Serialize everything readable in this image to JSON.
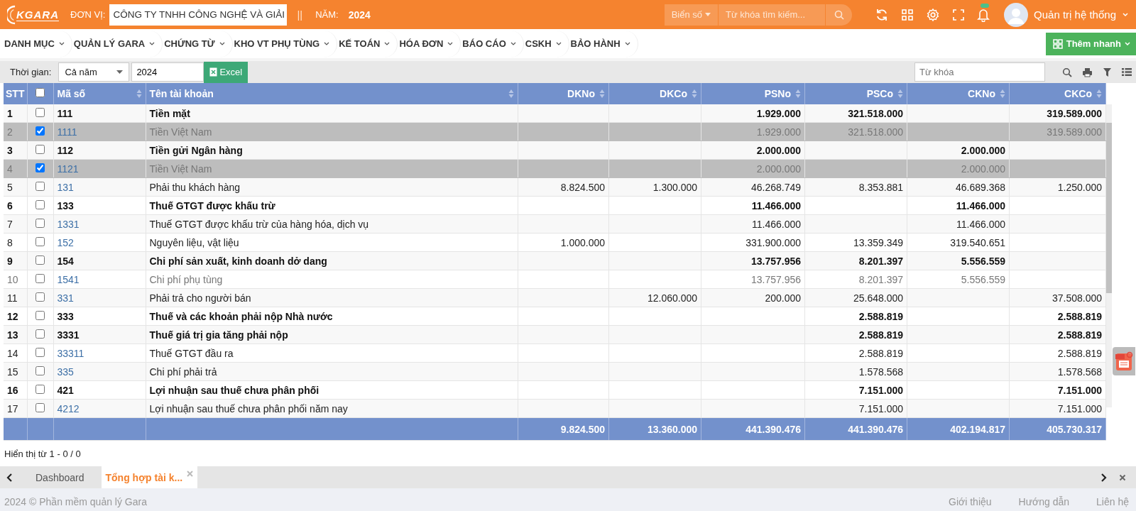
{
  "header": {
    "logo": "KGARA",
    "unit_label": "ĐƠN VỊ:",
    "unit_value": "CÔNG TY TNHH CÔNG NGHỆ VÀ GIẢI",
    "separator": "||",
    "year_label": "NĂM:",
    "year": "2024",
    "plate_filter": "Biển số",
    "search": {
      "placeholder": "Từ khóa tìm kiếm..."
    },
    "user": "Quản trị hệ thống"
  },
  "menu": [
    {
      "label": "DANH MỤC"
    },
    {
      "label": "QUẢN LÝ GARA"
    },
    {
      "label": "CHỨNG TỪ"
    },
    {
      "label": "KHO VT PHỤ TÙNG"
    },
    {
      "label": "KẾ TOÁN"
    },
    {
      "label": "HÓA ĐƠN"
    },
    {
      "label": "BÁO CÁO"
    },
    {
      "label": "CSKH"
    },
    {
      "label": "BẢO HÀNH"
    }
  ],
  "quick_add": "Thêm nhanh",
  "toolbar": {
    "time_label": "Thời gian:",
    "period": "Cả năm",
    "year": "2024",
    "excel": "Excel",
    "keyword": {
      "placeholder": "Từ khóa"
    }
  },
  "table": {
    "select_all_checked": false,
    "columns": [
      {
        "label": "STT"
      },
      {
        "label": "Mã số",
        "sortable": true
      },
      {
        "label": "Tên tài khoản",
        "sortable": true
      },
      {
        "label": "DKNo",
        "sortable": true
      },
      {
        "label": "DKCo",
        "sortable": true
      },
      {
        "label": "PSNo",
        "sortable": true
      },
      {
        "label": "PSCo",
        "sortable": true
      },
      {
        "label": "CKNo",
        "sortable": true
      },
      {
        "label": "CKCo",
        "sortable": true
      }
    ],
    "rows": [
      {
        "stt": "1",
        "code": "111",
        "name": "Tiền mặt",
        "kind": "group",
        "selected": false,
        "dimmed": false,
        "amounts": {
          "psno": "1.929.000",
          "psco": "321.518.000",
          "ckco": "319.589.000"
        }
      },
      {
        "stt": "2",
        "code": "1111",
        "name": "Tiền Việt Nam",
        "kind": "detail",
        "selected": true,
        "dimmed": true,
        "amounts": {
          "psno": "1.929.000",
          "psco": "321.518.000",
          "ckco": "319.589.000"
        }
      },
      {
        "stt": "3",
        "code": "112",
        "name": "Tiền gửi Ngân hàng",
        "kind": "group",
        "selected": false,
        "dimmed": false,
        "amounts": {
          "psno": "2.000.000",
          "ckno": "2.000.000"
        }
      },
      {
        "stt": "4",
        "code": "1121",
        "name": "Tiền Việt Nam",
        "kind": "detail",
        "selected": true,
        "dimmed": true,
        "amounts": {
          "psno": "2.000.000",
          "ckno": "2.000.000"
        }
      },
      {
        "stt": "5",
        "code": "131",
        "name": "Phải thu khách hàng",
        "kind": "detail",
        "selected": false,
        "dimmed": false,
        "amounts": {
          "dkno": "8.824.500",
          "dkco": "1.300.000",
          "psno": "46.268.749",
          "psco": "8.353.881",
          "ckno": "46.689.368",
          "ckco": "1.250.000"
        }
      },
      {
        "stt": "6",
        "code": "133",
        "name": "Thuế GTGT được khấu trừ",
        "kind": "group",
        "selected": false,
        "dimmed": false,
        "amounts": {
          "psno": "11.466.000",
          "ckno": "11.466.000"
        }
      },
      {
        "stt": "7",
        "code": "1331",
        "name": "Thuế GTGT được khấu trừ của hàng hóa, dịch vụ",
        "kind": "detail",
        "selected": false,
        "dimmed": false,
        "amounts": {
          "psno": "11.466.000",
          "ckno": "11.466.000"
        }
      },
      {
        "stt": "8",
        "code": "152",
        "name": "Nguyên liệu, vật liệu",
        "kind": "detail",
        "selected": false,
        "dimmed": false,
        "amounts": {
          "dkno": "1.000.000",
          "psno": "331.900.000",
          "psco": "13.359.349",
          "ckno": "319.540.651"
        }
      },
      {
        "stt": "9",
        "code": "154",
        "name": "Chi phí sản xuất, kinh doanh dở dang",
        "kind": "group",
        "selected": false,
        "dimmed": false,
        "amounts": {
          "psno": "13.757.956",
          "psco": "8.201.397",
          "ckno": "5.556.559"
        }
      },
      {
        "stt": "10",
        "code": "1541",
        "name": "Chi phí phụ tùng",
        "kind": "detail",
        "selected": false,
        "dimmed": true,
        "amounts": {
          "psno": "13.757.956",
          "psco": "8.201.397",
          "ckno": "5.556.559"
        }
      },
      {
        "stt": "11",
        "code": "331",
        "name": "Phải trả cho người bán",
        "kind": "detail",
        "selected": false,
        "dimmed": false,
        "amounts": {
          "dkco": "12.060.000",
          "psno": "200.000",
          "psco": "25.648.000",
          "ckco": "37.508.000"
        }
      },
      {
        "stt": "12",
        "code": "333",
        "name": "Thuế và các khoản phải nộp Nhà nước",
        "kind": "group",
        "selected": false,
        "dimmed": false,
        "amounts": {
          "psco": "2.588.819",
          "ckco": "2.588.819"
        }
      },
      {
        "stt": "13",
        "code": "3331",
        "name": "Thuế giá trị gia tăng phải nộp",
        "kind": "group",
        "selected": false,
        "dimmed": false,
        "amounts": {
          "psco": "2.588.819",
          "ckco": "2.588.819"
        }
      },
      {
        "stt": "14",
        "code": "33311",
        "name": "Thuế GTGT đầu ra",
        "kind": "detail",
        "selected": false,
        "dimmed": false,
        "amounts": {
          "psco": "2.588.819",
          "ckco": "2.588.819"
        }
      },
      {
        "stt": "15",
        "code": "335",
        "name": "Chi phí phải trả",
        "kind": "detail",
        "selected": false,
        "dimmed": false,
        "amounts": {
          "psco": "1.578.568",
          "ckco": "1.578.568"
        }
      },
      {
        "stt": "16",
        "code": "421",
        "name": "Lợi nhuận sau thuế chưa phân phối",
        "kind": "group",
        "selected": false,
        "dimmed": false,
        "amounts": {
          "psco": "7.151.000",
          "ckco": "7.151.000"
        }
      },
      {
        "stt": "17",
        "code": "4212",
        "name": "Lợi nhuận sau thuế chưa phân phối năm nay",
        "kind": "detail",
        "selected": false,
        "dimmed": false,
        "amounts": {
          "psco": "7.151.000",
          "ckco": "7.151.000"
        }
      }
    ],
    "totals": [
      "9.824.500",
      "13.360.000",
      "441.390.476",
      "441.390.476",
      "402.194.817",
      "405.730.317"
    ]
  },
  "pager": "Hiển thị từ 1 - 0 / 0",
  "tabs": [
    {
      "label": "Dashboard",
      "selected": false,
      "closable": false
    },
    {
      "label": "Tổng hợp tài k...",
      "selected": true,
      "closable": true
    }
  ],
  "footer": {
    "copyright": "2024 © Phần mềm quản lý Gara",
    "links": [
      "Giới thiệu",
      "Hướng dẫn",
      "Liên hệ"
    ]
  }
}
